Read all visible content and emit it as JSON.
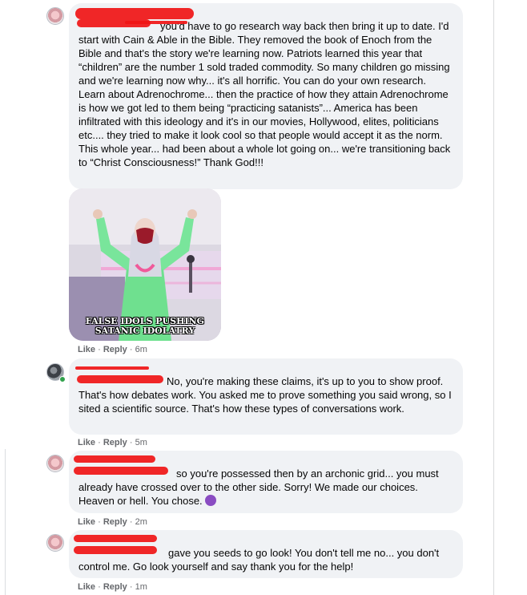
{
  "comments": [
    {
      "text": "you'd have to go research way back then bring it up to date. I'd start with Cain & Able in the Bible. They removed the book of Enoch from the Bible and that's the story we're learning now. Patriots learned this year that “children” are the number 1 sold traded commodity. So many children go missing and we're learning now why... it's all horrific. You can do your own research. Learn about Adrenochrome... then the practice of how they attain Adrenochrome is how we got led to them being “practicing satanists”... America has been infiltrated with this ideology and it's in our movies, Hollywood, elites, politicians etc.... they tried to make it look cool so that people would accept it as the norm.\nThis whole year... had been about a whole lot going on... we're transitioning back to “Christ Consciousness!” Thank God!!!",
      "image_caption": "FALSE IDOLS PUSHING SATANIC IDOLATRY",
      "like": "Like",
      "reply": "Reply",
      "time": "6m"
    },
    {
      "text": "No, you're making these claims, it's up to you to show proof. That's how debates work. You asked me to prove something you said wrong, so I sited a scientific source. That's how these types of conversations work.",
      "like": "Like",
      "reply": "Reply",
      "time": "5m"
    },
    {
      "text": "so you're possessed then by an archonic grid... you must already have crossed over to the other side. Sorry! We made our choices. Heaven or hell. You chose.",
      "emoji": "smiling-devil-emoji",
      "like": "Like",
      "reply": "Reply",
      "time": "2m"
    },
    {
      "text": "gave you seeds to go look! You don't tell me no... you don't control me. Go look yourself and say thank you for the help!",
      "like": "Like",
      "reply": "Reply",
      "time": "1m"
    }
  ],
  "separator": "·",
  "colors": {
    "bubble": "#f0f2f5",
    "meta_text": "#65676b",
    "redaction": "#f01515",
    "online": "#31a24c"
  }
}
